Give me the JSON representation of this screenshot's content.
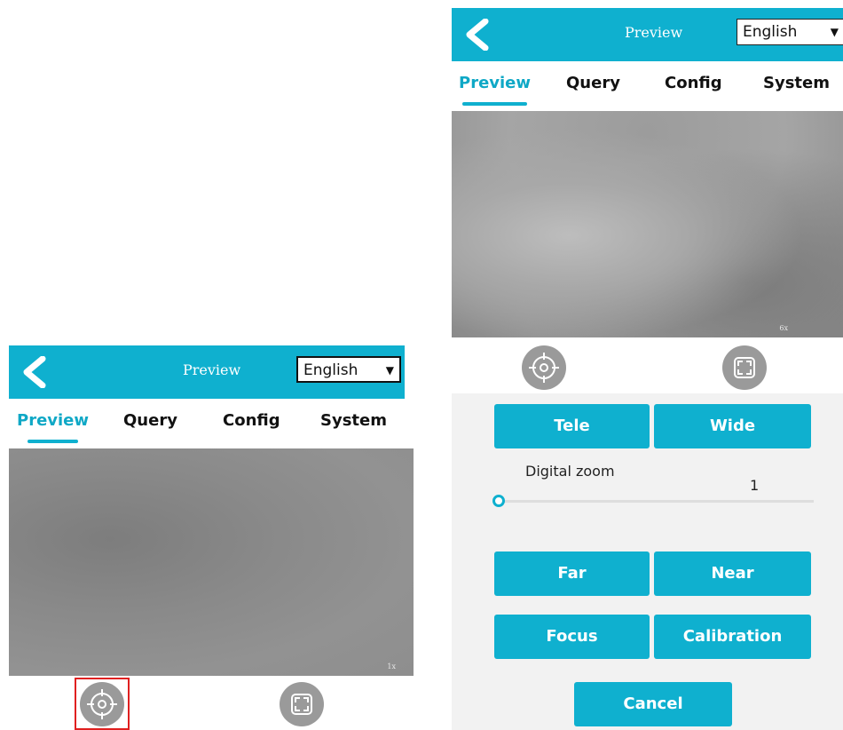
{
  "left_screen": {
    "header": {
      "title": "Preview",
      "language": "English"
    },
    "tabs": [
      {
        "label": "Preview",
        "active": true
      },
      {
        "label": "Query"
      },
      {
        "label": "Config"
      },
      {
        "label": "System"
      }
    ],
    "video": {
      "zoom_indicator": "1x"
    },
    "controls": {
      "ptz_icon": "crosshair-icon",
      "fullscreen_icon": "fullscreen-icon",
      "highlighted": "crosshair-icon"
    }
  },
  "right_screen": {
    "header": {
      "title": "Preview",
      "language": "English"
    },
    "tabs": [
      {
        "label": "Preview",
        "active": true
      },
      {
        "label": "Query"
      },
      {
        "label": "Config"
      },
      {
        "label": "System"
      }
    ],
    "video": {
      "zoom_indicator": "6x"
    },
    "controls": {
      "ptz_icon": "crosshair-icon",
      "fullscreen_icon": "fullscreen-icon"
    },
    "panel": {
      "tele": "Tele",
      "wide": "Wide",
      "digital_zoom_label": "Digital zoom",
      "digital_zoom_value": "1",
      "far": "Far",
      "near": "Near",
      "focus": "Focus",
      "calibration": "Calibration",
      "cancel": "Cancel"
    }
  },
  "colors": {
    "accent": "#0fb0cf",
    "highlight": "#e02020",
    "icon_bg": "#9a9a9a"
  }
}
